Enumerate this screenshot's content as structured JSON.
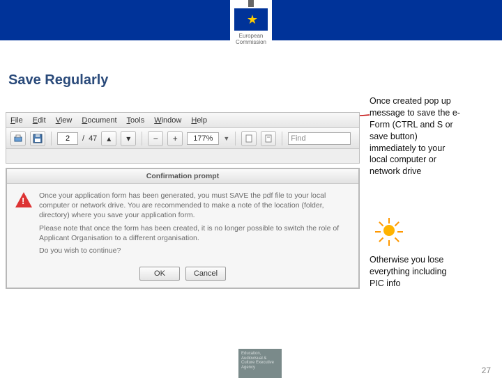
{
  "logo": {
    "org_line1": "European",
    "org_line2": "Commission"
  },
  "heading": "Save Regularly",
  "menubar": {
    "file": "File",
    "edit": "Edit",
    "view": "View",
    "document": "Document",
    "tools": "Tools",
    "window": "Window",
    "help": "Help"
  },
  "toolbar": {
    "page_current": "2",
    "page_sep": "/",
    "page_total": "47",
    "zoom": "177%",
    "find_placeholder": "Find"
  },
  "dialog": {
    "title": "Confirmation prompt",
    "l1": "Once your application form has been generated, you must SAVE the pdf file to your local computer or network drive. You are recommended to make a note of the location (folder, directory) where you save your application form.",
    "l2": "Please note that once the form has been created, it is no longer possible to switch the role of Applicant Organisation to a different organisation.",
    "l3": "Do you wish to continue?",
    "ok": "OK",
    "cancel": "Cancel"
  },
  "right": {
    "p1": "Once created pop up message to save the e-Form (CTRL and S or save button) immediately to your local computer or network drive",
    "p2": "Otherwise you lose everything including PIC info"
  },
  "footer_logo": "Education, Audiovisual & Culture Executive Agency",
  "page_number": "27"
}
